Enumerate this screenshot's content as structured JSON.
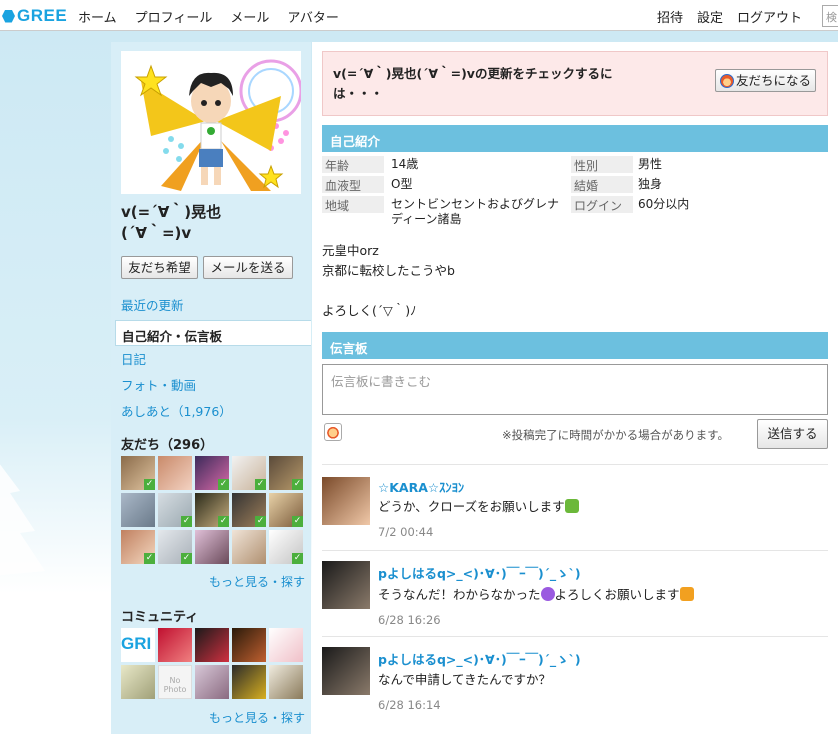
{
  "nav": {
    "logo": "GREE",
    "left": [
      "ホーム",
      "プロフィール",
      "メール",
      "アバター"
    ],
    "right": [
      "招待",
      "設定",
      "ログアウト"
    ],
    "search_glyph": "検"
  },
  "profile": {
    "name_line1": "v(=´∀｀)晃也",
    "name_line2": "(´∀｀=)v",
    "btn_friend_request": "友だち希望",
    "btn_send_mail": "メールを送る"
  },
  "sidebar": {
    "recent": "最近の更新",
    "selected": "自己紹介・伝言板",
    "diary": "日記",
    "photo": "フォト・動画",
    "footprints": "あしあと（1,976）",
    "friends_title": "友だち（296）",
    "friends_more": "もっと見る・探す",
    "community_title": "コミュニティ",
    "community_more": "もっと見る・探す",
    "community_gree_text": "GRI",
    "community_photo_text": "No Photo"
  },
  "notice": {
    "text": "v(=´∀｀)晃也(´∀｀=)vの更新をチェックするには・・・",
    "button": "友だちになる"
  },
  "intro": {
    "title": "自己紹介",
    "fields": [
      {
        "label": "年齢",
        "value": "14歳"
      },
      {
        "label": "性別",
        "value": "男性"
      },
      {
        "label": "血液型",
        "value": "O型"
      },
      {
        "label": "結婚",
        "value": "独身"
      },
      {
        "label": "地域",
        "value": "セントビンセントおよびグレナディーン諸島"
      },
      {
        "label": "ログイン",
        "value": "60分以内"
      }
    ],
    "bio": [
      "元皇中orz",
      "京都に転校したこうやb",
      "",
      "よろしく(´▽｀)ﾉ"
    ]
  },
  "board": {
    "title": "伝言板",
    "placeholder": "伝言板に書きこむ",
    "note": "※投稿完了に時間がかかる場合があります。",
    "send": "送信する",
    "messages": [
      {
        "name": "☆KARA☆ｽﾝﾖﾝ",
        "text": "どうか、クローズをお願いします",
        "time": "7/2 00:44"
      },
      {
        "name": "pよしはるq>_<)･∀･)￣ｰ￣)´_ゝ`)",
        "text_before": "そうなんだ！わからなかった",
        "text_after": "よろしくお願いします",
        "time": "6/28 16:26"
      },
      {
        "name": "pよしはるq>_<)･∀･)￣ｰ￣)´_ゝ`)",
        "text": "なんで申請してきたんですか？",
        "time": "6/28 16:14"
      }
    ]
  },
  "colors": {
    "accent": "#1a8fcf",
    "header_blue": "#6cc0df",
    "notice_bg": "#fde9e9",
    "check_green": "#4caf3d"
  }
}
